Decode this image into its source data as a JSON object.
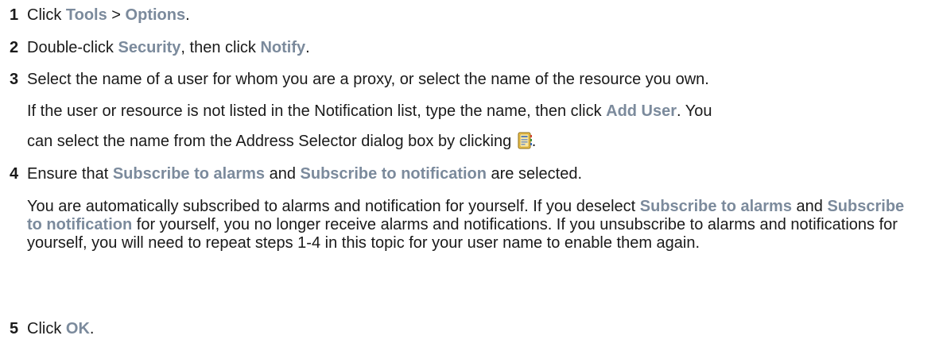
{
  "steps": [
    {
      "number": "1",
      "t1": "Click ",
      "ui1": "Tools",
      "t2": " > ",
      "ui2": "Options",
      "t3": "."
    },
    {
      "number": "2",
      "t1": "Double-click ",
      "ui1": "Security",
      "t2": ", then click ",
      "ui2": "Notify",
      "t3": "."
    },
    {
      "number": "3",
      "text": "Select the name of a user for whom you are a proxy, or select the name of the resource you own.",
      "p1_t1": "If the user or resource is not listed in the Notification list, type the name, then click ",
      "p1_ui": "Add User",
      "p1_t2": ". You",
      "p2_t1": "can select the name from the Address Selector dialog box by clicking ",
      "p2_t2": ".",
      "icon": "address-book-icon"
    },
    {
      "number": "4",
      "t1": "Ensure that ",
      "ui1": "Subscribe to alarms",
      "t2": " and ",
      "ui2": "Subscribe to notification",
      "t3": " are selected.",
      "p_t1": "You are automatically subscribed to alarms and notification for yourself. If you deselect ",
      "p_ui1": "Subscribe to alarms",
      "p_t2": " and ",
      "p_ui2": "Subscribe to notification",
      "p_t3": " for yourself, you no longer receive alarms and notifications. If you unsubscribe to alarms and notifications for yourself, you will need to repeat steps 1-4 in this topic for your user name to enable them again."
    },
    {
      "number": "5",
      "t1": "Click ",
      "ui1": "OK",
      "t2": "."
    }
  ],
  "colors": {
    "text": "#1a1a1a",
    "ui_term": "#7b8a9c"
  }
}
